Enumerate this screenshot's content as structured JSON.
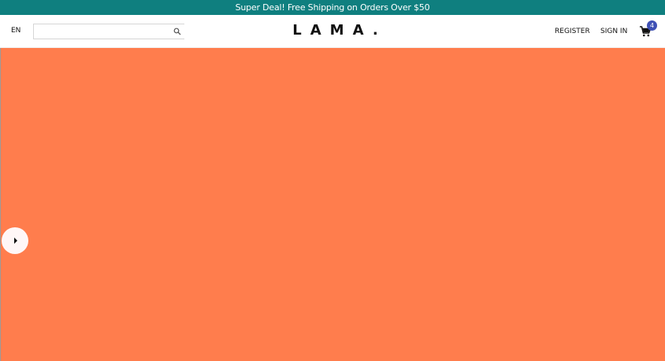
{
  "announcement": {
    "text": "Super Deal! Free Shipping on Orders Over $50",
    "background": "#0f7f7f"
  },
  "navbar": {
    "language": "EN",
    "search": {
      "placeholder": "",
      "value": "",
      "icon": "search-icon"
    },
    "logo": "LAMA.",
    "register_label": "REGISTER",
    "signin_label": "SIGN IN",
    "cart": {
      "icon": "shopping-cart-icon",
      "badge_count": "4",
      "badge_color": "#3f51b5"
    }
  },
  "hero": {
    "background": "#ff7d4d",
    "arrow_icon": "arrow-right-icon"
  }
}
